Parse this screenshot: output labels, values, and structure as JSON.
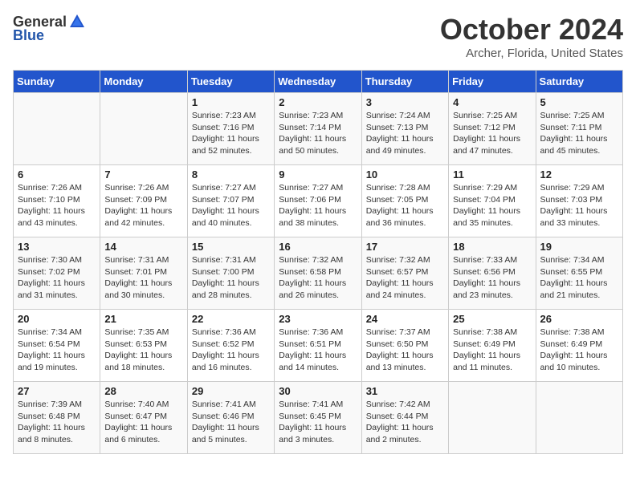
{
  "header": {
    "logo_general": "General",
    "logo_blue": "Blue",
    "month_title": "October 2024",
    "location": "Archer, Florida, United States"
  },
  "days_of_week": [
    "Sunday",
    "Monday",
    "Tuesday",
    "Wednesday",
    "Thursday",
    "Friday",
    "Saturday"
  ],
  "weeks": [
    [
      {
        "day": "",
        "info": ""
      },
      {
        "day": "",
        "info": ""
      },
      {
        "day": "1",
        "info": "Sunrise: 7:23 AM\nSunset: 7:16 PM\nDaylight: 11 hours and 52 minutes."
      },
      {
        "day": "2",
        "info": "Sunrise: 7:23 AM\nSunset: 7:14 PM\nDaylight: 11 hours and 50 minutes."
      },
      {
        "day": "3",
        "info": "Sunrise: 7:24 AM\nSunset: 7:13 PM\nDaylight: 11 hours and 49 minutes."
      },
      {
        "day": "4",
        "info": "Sunrise: 7:25 AM\nSunset: 7:12 PM\nDaylight: 11 hours and 47 minutes."
      },
      {
        "day": "5",
        "info": "Sunrise: 7:25 AM\nSunset: 7:11 PM\nDaylight: 11 hours and 45 minutes."
      }
    ],
    [
      {
        "day": "6",
        "info": "Sunrise: 7:26 AM\nSunset: 7:10 PM\nDaylight: 11 hours and 43 minutes."
      },
      {
        "day": "7",
        "info": "Sunrise: 7:26 AM\nSunset: 7:09 PM\nDaylight: 11 hours and 42 minutes."
      },
      {
        "day": "8",
        "info": "Sunrise: 7:27 AM\nSunset: 7:07 PM\nDaylight: 11 hours and 40 minutes."
      },
      {
        "day": "9",
        "info": "Sunrise: 7:27 AM\nSunset: 7:06 PM\nDaylight: 11 hours and 38 minutes."
      },
      {
        "day": "10",
        "info": "Sunrise: 7:28 AM\nSunset: 7:05 PM\nDaylight: 11 hours and 36 minutes."
      },
      {
        "day": "11",
        "info": "Sunrise: 7:29 AM\nSunset: 7:04 PM\nDaylight: 11 hours and 35 minutes."
      },
      {
        "day": "12",
        "info": "Sunrise: 7:29 AM\nSunset: 7:03 PM\nDaylight: 11 hours and 33 minutes."
      }
    ],
    [
      {
        "day": "13",
        "info": "Sunrise: 7:30 AM\nSunset: 7:02 PM\nDaylight: 11 hours and 31 minutes."
      },
      {
        "day": "14",
        "info": "Sunrise: 7:31 AM\nSunset: 7:01 PM\nDaylight: 11 hours and 30 minutes."
      },
      {
        "day": "15",
        "info": "Sunrise: 7:31 AM\nSunset: 7:00 PM\nDaylight: 11 hours and 28 minutes."
      },
      {
        "day": "16",
        "info": "Sunrise: 7:32 AM\nSunset: 6:58 PM\nDaylight: 11 hours and 26 minutes."
      },
      {
        "day": "17",
        "info": "Sunrise: 7:32 AM\nSunset: 6:57 PM\nDaylight: 11 hours and 24 minutes."
      },
      {
        "day": "18",
        "info": "Sunrise: 7:33 AM\nSunset: 6:56 PM\nDaylight: 11 hours and 23 minutes."
      },
      {
        "day": "19",
        "info": "Sunrise: 7:34 AM\nSunset: 6:55 PM\nDaylight: 11 hours and 21 minutes."
      }
    ],
    [
      {
        "day": "20",
        "info": "Sunrise: 7:34 AM\nSunset: 6:54 PM\nDaylight: 11 hours and 19 minutes."
      },
      {
        "day": "21",
        "info": "Sunrise: 7:35 AM\nSunset: 6:53 PM\nDaylight: 11 hours and 18 minutes."
      },
      {
        "day": "22",
        "info": "Sunrise: 7:36 AM\nSunset: 6:52 PM\nDaylight: 11 hours and 16 minutes."
      },
      {
        "day": "23",
        "info": "Sunrise: 7:36 AM\nSunset: 6:51 PM\nDaylight: 11 hours and 14 minutes."
      },
      {
        "day": "24",
        "info": "Sunrise: 7:37 AM\nSunset: 6:50 PM\nDaylight: 11 hours and 13 minutes."
      },
      {
        "day": "25",
        "info": "Sunrise: 7:38 AM\nSunset: 6:49 PM\nDaylight: 11 hours and 11 minutes."
      },
      {
        "day": "26",
        "info": "Sunrise: 7:38 AM\nSunset: 6:49 PM\nDaylight: 11 hours and 10 minutes."
      }
    ],
    [
      {
        "day": "27",
        "info": "Sunrise: 7:39 AM\nSunset: 6:48 PM\nDaylight: 11 hours and 8 minutes."
      },
      {
        "day": "28",
        "info": "Sunrise: 7:40 AM\nSunset: 6:47 PM\nDaylight: 11 hours and 6 minutes."
      },
      {
        "day": "29",
        "info": "Sunrise: 7:41 AM\nSunset: 6:46 PM\nDaylight: 11 hours and 5 minutes."
      },
      {
        "day": "30",
        "info": "Sunrise: 7:41 AM\nSunset: 6:45 PM\nDaylight: 11 hours and 3 minutes."
      },
      {
        "day": "31",
        "info": "Sunrise: 7:42 AM\nSunset: 6:44 PM\nDaylight: 11 hours and 2 minutes."
      },
      {
        "day": "",
        "info": ""
      },
      {
        "day": "",
        "info": ""
      }
    ]
  ]
}
